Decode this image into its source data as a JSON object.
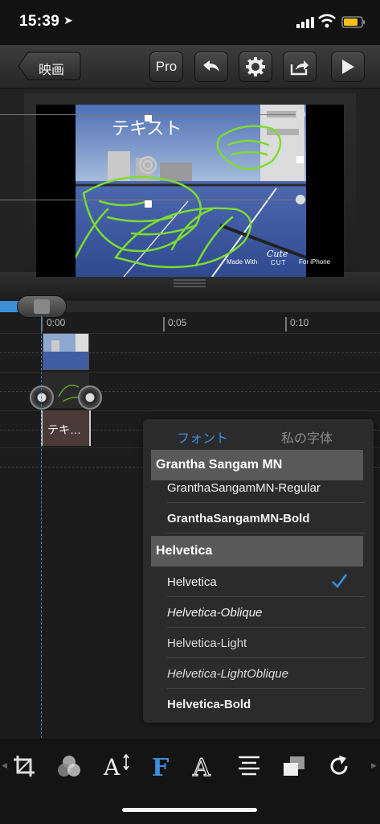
{
  "status_bar": {
    "time": "15:39"
  },
  "toolbar": {
    "back_label": "映画",
    "pro_label": "Pro"
  },
  "preview": {
    "overlay_text": "テキスト",
    "watermark_left": "Made With",
    "watermark_brand_top": "Cute",
    "watermark_brand_bottom": "CUT",
    "watermark_right": "For iPhone"
  },
  "timeline": {
    "ruler": [
      "0:00",
      "0:05",
      "0:10"
    ],
    "text_clip_label": "テキ…"
  },
  "font_picker": {
    "tabs": [
      {
        "label": "フォント",
        "active": true
      },
      {
        "label": "私の字体",
        "active": false
      }
    ],
    "groups": [
      {
        "name": "Grantha Sangam MN",
        "fonts": [
          "GranthaSangamMN-Regular",
          "GranthaSangamMN-Bold"
        ]
      },
      {
        "name": "Helvetica",
        "fonts": [
          "Helvetica",
          "Helvetica-Oblique",
          "Helvetica-Light",
          "Helvetica-LightOblique",
          "Helvetica-Bold"
        ]
      }
    ],
    "selected_font": "Helvetica"
  },
  "bottom_tools": [
    "crop-icon",
    "color-filter-icon",
    "text-size-icon",
    "font-icon",
    "outline-font-icon",
    "align-icon",
    "layer-order-icon",
    "redo-icon"
  ],
  "colors": {
    "accent": "#3a8fe0",
    "drawing": "#7ddc2f"
  }
}
